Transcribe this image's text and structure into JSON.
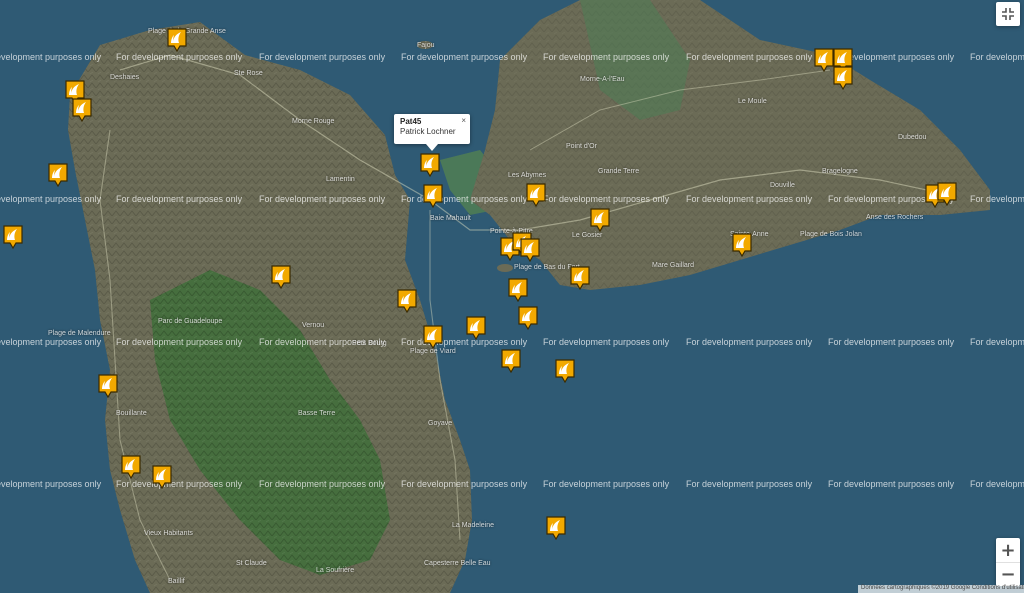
{
  "map": {
    "watermark_text": "For development purposes only",
    "terms_text": "Données cartographiques ©2019 Google   Conditions d'utilisation",
    "place_labels": {
      "deshaies": "Deshaies",
      "plage_grande_anse": "Plage de la Grande Anse",
      "ste_rose": "Ste Rose",
      "fajou": "Fajou",
      "morne_rouge": "Morne Rouge",
      "lamentin": "Lamentin",
      "baie_mahault": "Baie Mahault",
      "pointe_a_pitre": "Pointe-à-Pitre",
      "les_abymes": "Les Abymes",
      "point_dor": "Point d'Or",
      "grande_terre": "Grande Terre",
      "morne_a_leau": "Morne-A-l'Eau",
      "le_moule": "Le Moule",
      "dubedou": "Dubedou",
      "douville": "Douville",
      "bragelogne": "Bragelogne",
      "anse_rochers": "Anse des Rochers",
      "plage_bois_jolan": "Plage de Bois Jolan",
      "mare_gaillard": "Mare Gaillard",
      "le_gosier": "Le Gosier",
      "plage_bas_du_fort": "Plage de Bas du Fort",
      "plage_malendure": "Plage de Malendure",
      "parc_guadeloupe": "Parc de Guadeloupe",
      "vernou": "Vernou",
      "petit_bourg": "Petit Bourg",
      "plage_viard": "Plage de Viard",
      "basse_terre": "Basse Terre",
      "bouillante": "Bouillante",
      "goyave": "Goyave",
      "vieux_habitants": "Vieux Habitants",
      "la_madeleine": "La Madeleine",
      "st_claude": "St Claude",
      "capesterre": "Capesterre Belle Eau",
      "la_soufriere": "La Soufrière",
      "baillif": "Baillif",
      "sainte_anne": "Sainte-Anne"
    }
  },
  "popup": {
    "title": "Pat45",
    "subtitle": "Patrick Lochner",
    "close": "×"
  },
  "controls": {
    "fullscreen_icon": "exit-fullscreen",
    "zoom_in": "+",
    "zoom_out": "−"
  },
  "marker_icon": "sailboat-marker",
  "colors": {
    "sea": "#2f5a74",
    "land": "#6b6b56",
    "forest": "#3f6e3a",
    "marker_fill": "#f2a900",
    "marker_border": "#3a2a00"
  }
}
